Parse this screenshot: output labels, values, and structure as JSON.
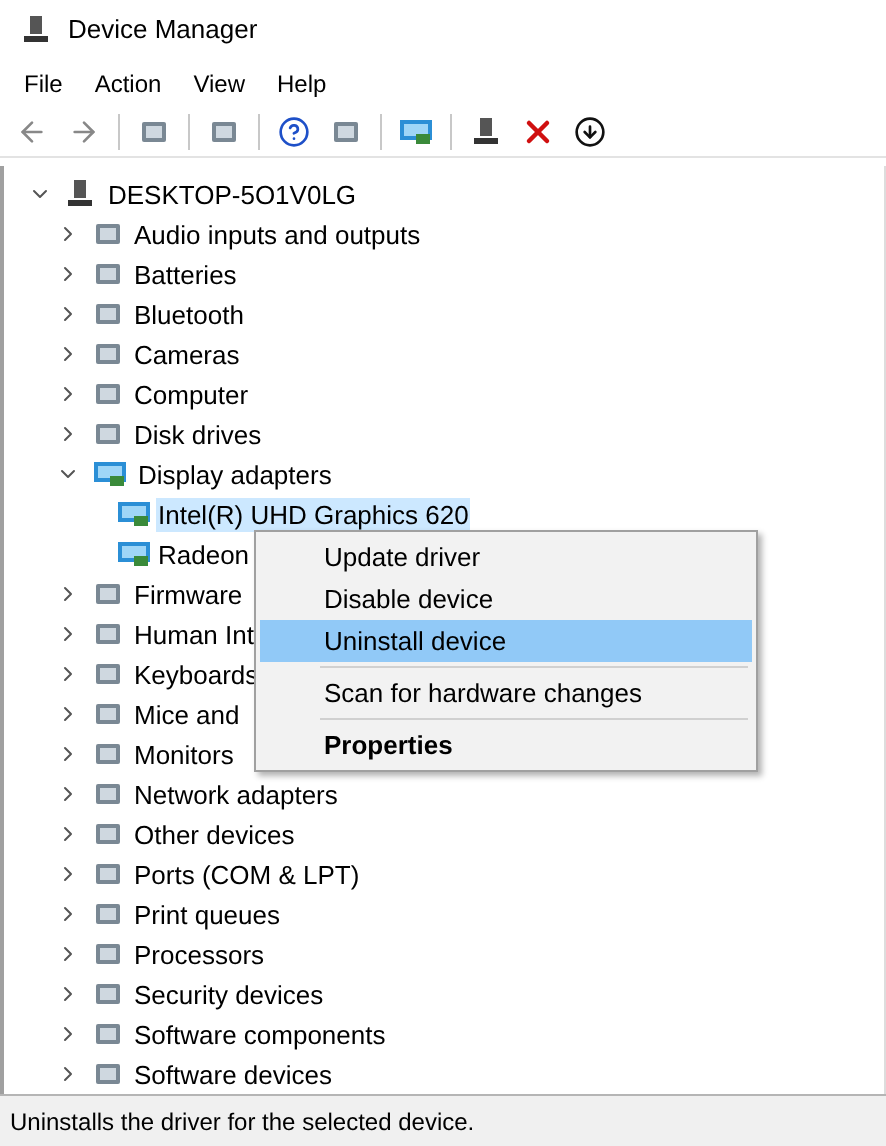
{
  "window": {
    "title": "Device Manager"
  },
  "menu_bar": [
    "File",
    "Action",
    "View",
    "Help"
  ],
  "tree": {
    "label": "DESKTOP-5O1V0LG",
    "expanded": true,
    "children": [
      {
        "label": "Audio inputs and outputs",
        "expanded": false,
        "selected": false
      },
      {
        "label": "Batteries",
        "expanded": false,
        "selected": false
      },
      {
        "label": "Bluetooth",
        "expanded": false,
        "selected": false
      },
      {
        "label": "Cameras",
        "expanded": false,
        "selected": false
      },
      {
        "label": "Computer",
        "expanded": false,
        "selected": false
      },
      {
        "label": "Disk drives",
        "expanded": false,
        "selected": false
      },
      {
        "label": "Display adapters",
        "expanded": true,
        "selected": false,
        "children": [
          {
            "label": "Intel(R) UHD Graphics 620",
            "selected": true
          },
          {
            "label": "Radeon",
            "selected": false
          }
        ]
      },
      {
        "label": "Firmware",
        "expanded": false,
        "selected": false
      },
      {
        "label": "Human Int",
        "expanded": false,
        "selected": false
      },
      {
        "label": "Keyboards",
        "expanded": false,
        "selected": false
      },
      {
        "label": "Mice and",
        "expanded": false,
        "selected": false
      },
      {
        "label": "Monitors",
        "expanded": false,
        "selected": false
      },
      {
        "label": "Network adapters",
        "expanded": false,
        "selected": false
      },
      {
        "label": "Other devices",
        "expanded": false,
        "selected": false
      },
      {
        "label": "Ports (COM & LPT)",
        "expanded": false,
        "selected": false
      },
      {
        "label": "Print queues",
        "expanded": false,
        "selected": false
      },
      {
        "label": "Processors",
        "expanded": false,
        "selected": false
      },
      {
        "label": "Security devices",
        "expanded": false,
        "selected": false
      },
      {
        "label": "Software components",
        "expanded": false,
        "selected": false
      },
      {
        "label": "Software devices",
        "expanded": false,
        "selected": false
      }
    ]
  },
  "context_menu": [
    {
      "kind": "item",
      "label": "Update driver",
      "selected": false
    },
    {
      "kind": "item",
      "label": "Disable device",
      "selected": false
    },
    {
      "kind": "item",
      "label": "Uninstall device",
      "selected": true
    },
    {
      "kind": "separator"
    },
    {
      "kind": "item",
      "label": "Scan for hardware changes",
      "selected": false
    },
    {
      "kind": "separator"
    },
    {
      "kind": "default",
      "label": "Properties",
      "selected": false
    }
  ],
  "status_bar": "Uninstalls the driver for the selected device."
}
